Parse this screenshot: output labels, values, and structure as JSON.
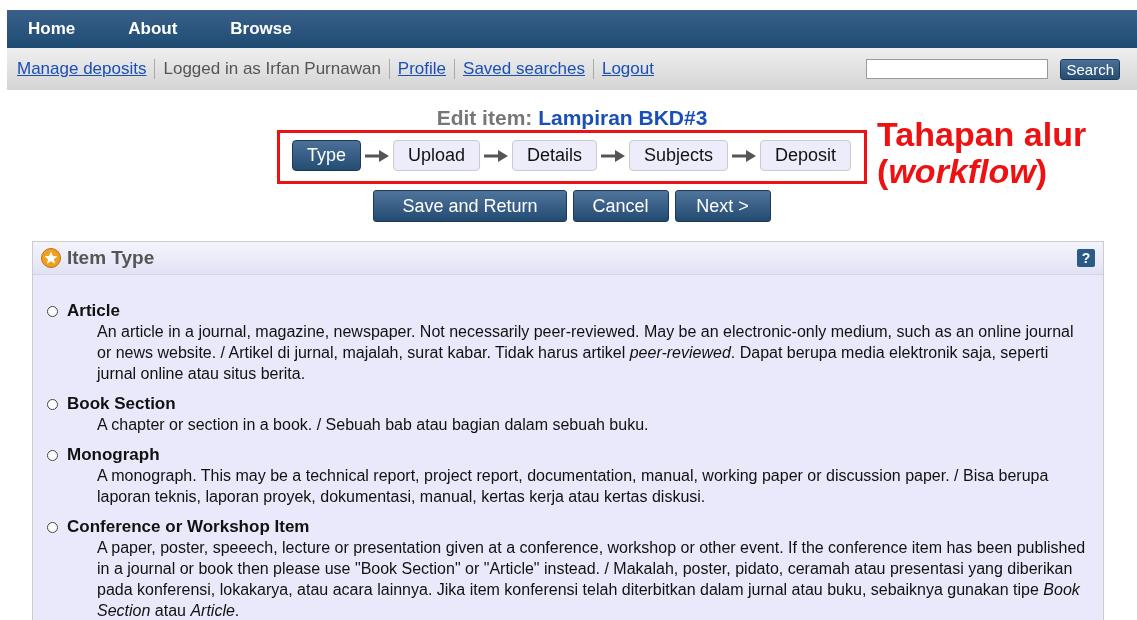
{
  "nav": [
    {
      "label": "Home"
    },
    {
      "label": "About"
    },
    {
      "label": "Browse"
    }
  ],
  "user_bar": {
    "items": [
      {
        "kind": "link",
        "text": "Manage deposits"
      },
      {
        "kind": "text",
        "text": "Logged in as Irfan Purnawan"
      },
      {
        "kind": "link",
        "text": "Profile"
      },
      {
        "kind": "link",
        "text": "Saved searches"
      },
      {
        "kind": "link",
        "text": "Logout"
      }
    ],
    "search_button": "Search"
  },
  "title": {
    "prefix": "Edit item:",
    "name": "Lampiran BKD#3"
  },
  "steps": [
    {
      "label": "Type",
      "selected": true
    },
    {
      "label": "Upload",
      "selected": false
    },
    {
      "label": "Details",
      "selected": false
    },
    {
      "label": "Subjects",
      "selected": false
    },
    {
      "label": "Deposit",
      "selected": false
    }
  ],
  "annotation": {
    "text": "Tahapan alur (*workflow*)"
  },
  "actions": [
    "Save and Return",
    "Cancel",
    "Next >"
  ],
  "panel": {
    "title": "Item Type",
    "help": "?",
    "options": [
      {
        "label": "Article",
        "selected": false,
        "description": "An article in a journal, magazine, newspaper. Not necessarily peer-reviewed. May be an electronic-only medium, such as an online journal or news website. / Artikel di jurnal, majalah, surat kabar. Tidak harus artikel *peer-reviewed*. Dapat berupa media elektronik saja, seperti jurnal online atau situs berita."
      },
      {
        "label": "Book Section",
        "selected": false,
        "description": "A chapter or section in a book. / Sebuah bab atau bagian dalam sebuah buku."
      },
      {
        "label": "Monograph",
        "selected": false,
        "description": "A monograph. This may be a technical report, project report, documentation, manual, working paper or discussion paper. / Bisa berupa laporan teknis, laporan proyek, dokumentasi, manual, kertas kerja atau kertas diskusi."
      },
      {
        "label": "Conference or Workshop Item",
        "selected": false,
        "description": "A paper, poster, speeech, lecture or presentation given at a conference, workshop or other event. If the conference item has been published in a journal or book then please use \"Book Section\" or \"Article\" instead. / Makalah, poster, pidato, ceramah atau presentasi yang diberikan pada konferensi, lokakarya, atau acara lainnya. Jika item konferensi telah diterbitkan dalam jurnal atau buku, sebaiknya gunakan tipe *Book Section* atau *Article*."
      }
    ]
  }
}
